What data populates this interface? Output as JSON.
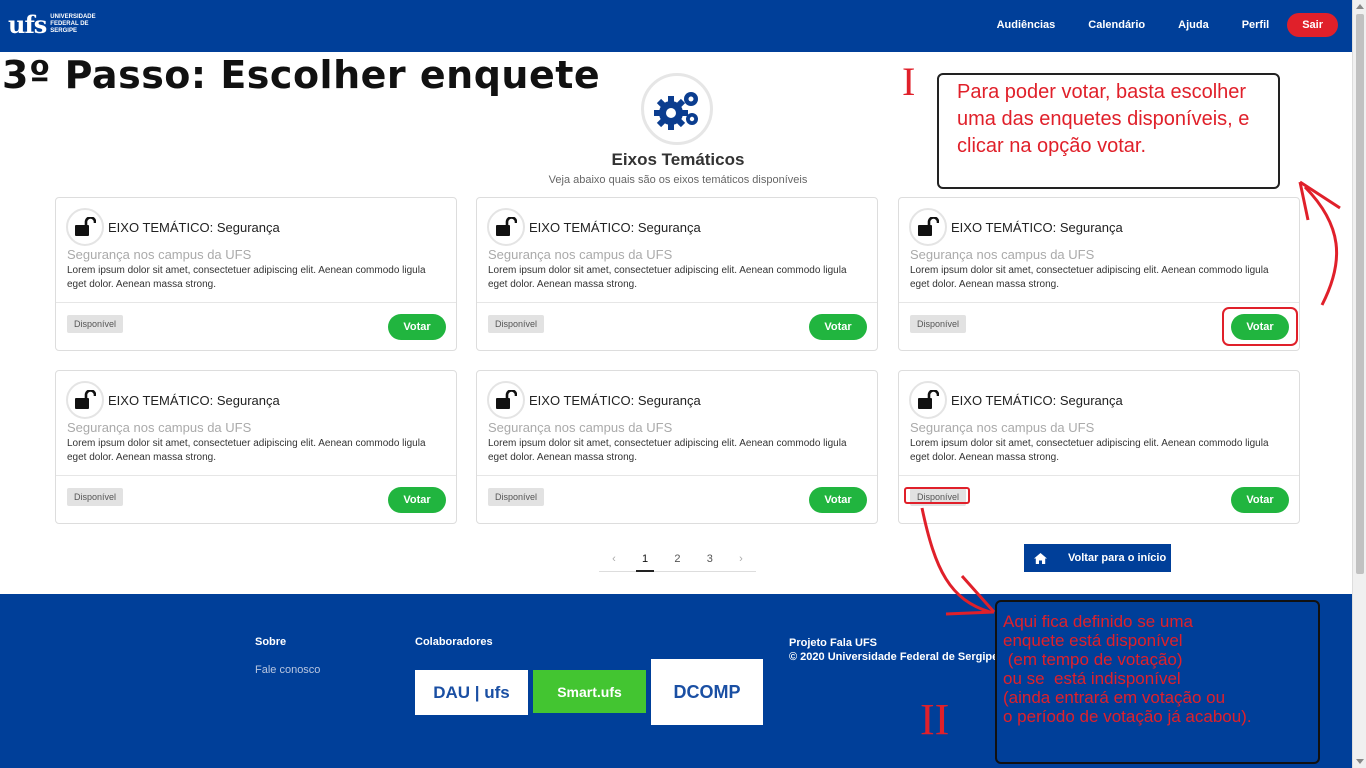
{
  "header": {
    "logo_mark": "ufs",
    "logo_text": "UNIVERSIDADE FEDERAL DE SERGIPE",
    "nav": [
      "Audiências",
      "Calendário",
      "Ajuda",
      "Perfil"
    ],
    "logout": "Sair"
  },
  "step_title": "3º Passo: Escolher enquete",
  "section": {
    "title": "Eixos Temáticos",
    "subtitle": "Veja abaixo quais são os eixos temáticos disponíveis"
  },
  "annotations": {
    "roman_1": "I",
    "roman_2": "II",
    "note_1": "Para poder votar, basta escolher uma das enquetes disponíveis, e clicar na opção votar.",
    "note_2": "Aqui fica definido se uma\nenquete está disponível\n (em tempo de votação)\nou se  está indisponível\n(ainda entrará em votação ou\no período de votação já acabou)."
  },
  "cards": [
    {
      "title": "EIXO TEMÁTICO: Segurança",
      "subtitle": "Segurança nos campus da UFS",
      "text": "Lorem ipsum dolor sit amet, consectetuer adipiscing elit. Aenean commodo ligula eget dolor. Aenean massa strong.",
      "status": "Disponível",
      "action": "Votar"
    },
    {
      "title": "EIXO TEMÁTICO: Segurança",
      "subtitle": "Segurança nos campus da UFS",
      "text": "Lorem ipsum dolor sit amet, consectetuer adipiscing elit. Aenean commodo ligula eget dolor. Aenean massa strong.",
      "status": "Disponível",
      "action": "Votar"
    },
    {
      "title": "EIXO TEMÁTICO: Segurança",
      "subtitle": "Segurança nos campus da UFS",
      "text": "Lorem ipsum dolor sit amet, consectetuer adipiscing elit. Aenean commodo ligula eget dolor. Aenean massa strong.",
      "status": "Disponível",
      "action": "Votar"
    },
    {
      "title": "EIXO TEMÁTICO: Segurança",
      "subtitle": "Segurança nos campus da UFS",
      "text": "Lorem ipsum dolor sit amet, consectetuer adipiscing elit. Aenean commodo ligula eget dolor. Aenean massa strong.",
      "status": "Disponível",
      "action": "Votar"
    },
    {
      "title": "EIXO TEMÁTICO: Segurança",
      "subtitle": "Segurança nos campus da UFS",
      "text": "Lorem ipsum dolor sit amet, consectetuer adipiscing elit. Aenean commodo ligula eget dolor. Aenean massa strong.",
      "status": "Disponível",
      "action": "Votar"
    },
    {
      "title": "EIXO TEMÁTICO: Segurança",
      "subtitle": "Segurança nos campus da UFS",
      "text": "Lorem ipsum dolor sit amet, consectetuer adipiscing elit. Aenean commodo ligula eget dolor. Aenean massa strong.",
      "status": "Disponível",
      "action": "Votar"
    }
  ],
  "pagination": {
    "prev": "‹",
    "pages": [
      "1",
      "2",
      "3"
    ],
    "next": "›",
    "current": "1"
  },
  "back_button": "Voltar para o início",
  "footer": {
    "about_heading": "Sobre",
    "contact_link": "Fale conosco",
    "collab_heading": "Colaboradores",
    "project_name": "Projeto Fala UFS",
    "copyright": "© 2020 Universidade Federal de Sergipe",
    "logos": {
      "dau": "DAU | ufs",
      "smart": "Smart.ufs",
      "dcomp": "DCOMP"
    }
  },
  "colors": {
    "brand": "#003f99",
    "vote": "#21b53f",
    "logout": "#e0202a",
    "annotation": "#e0202a"
  }
}
